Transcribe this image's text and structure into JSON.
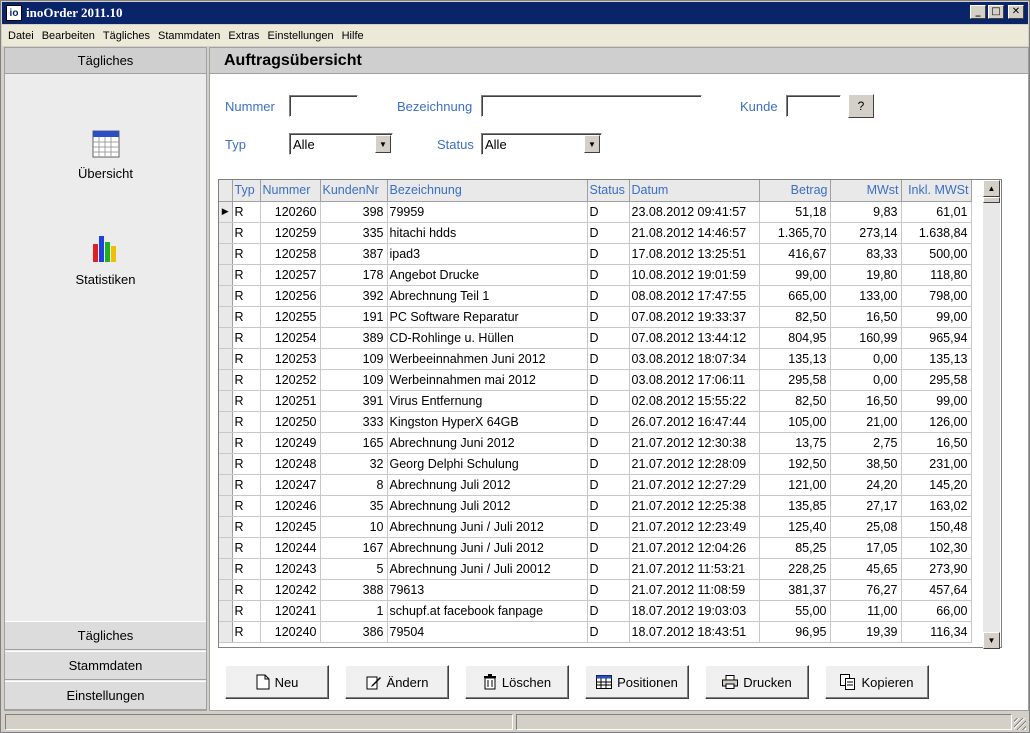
{
  "window": {
    "title": "inoOrder 2011.10",
    "icon_text": "io"
  },
  "menu": [
    "Datei",
    "Bearbeiten",
    "Tägliches",
    "Stammdaten",
    "Extras",
    "Einstellungen",
    "Hilfe"
  ],
  "sidebar": {
    "header": "Tägliches",
    "items": [
      {
        "label": "Übersicht",
        "icon": "calendar-icon"
      },
      {
        "label": "Statistiken",
        "icon": "bar-chart-icon"
      }
    ],
    "bottom_buttons": [
      "Tägliches",
      "Stammdaten",
      "Einstellungen"
    ]
  },
  "main": {
    "title": "Auftragsübersicht",
    "filters": {
      "nummer_label": "Nummer",
      "nummer_value": "",
      "bezeichnung_label": "Bezeichnung",
      "bezeichnung_value": "",
      "kunde_label": "Kunde",
      "kunde_value": "",
      "lookup_label": "?",
      "typ_label": "Typ",
      "typ_value": "Alle",
      "status_label": "Status",
      "status_value": "Alle"
    },
    "columns": [
      "Typ",
      "Nummer",
      "KundenNr",
      "Bezeichnung",
      "Status",
      "Datum",
      "Betrag",
      "MWst",
      "Inkl. MWSt"
    ],
    "rows": [
      [
        "R",
        "120260",
        "398",
        "79959",
        "D",
        "23.08.2012 09:41:57",
        "51,18",
        "9,83",
        "61,01"
      ],
      [
        "R",
        "120259",
        "335",
        "hitachi hdds",
        "D",
        "21.08.2012 14:46:57",
        "1.365,70",
        "273,14",
        "1.638,84"
      ],
      [
        "R",
        "120258",
        "387",
        "ipad3",
        "D",
        "17.08.2012 13:25:51",
        "416,67",
        "83,33",
        "500,00"
      ],
      [
        "R",
        "120257",
        "178",
        "Angebot Drucke",
        "D",
        "10.08.2012 19:01:59",
        "99,00",
        "19,80",
        "118,80"
      ],
      [
        "R",
        "120256",
        "392",
        "Abrechnung Teil 1",
        "D",
        "08.08.2012 17:47:55",
        "665,00",
        "133,00",
        "798,00"
      ],
      [
        "R",
        "120255",
        "191",
        "PC Software Reparatur",
        "D",
        "07.08.2012 19:33:37",
        "82,50",
        "16,50",
        "99,00"
      ],
      [
        "R",
        "120254",
        "389",
        "CD-Rohlinge u. Hüllen",
        "D",
        "07.08.2012 13:44:12",
        "804,95",
        "160,99",
        "965,94"
      ],
      [
        "R",
        "120253",
        "109",
        "Werbeeinnahmen Juni 2012",
        "D",
        "03.08.2012 18:07:34",
        "135,13",
        "0,00",
        "135,13"
      ],
      [
        "R",
        "120252",
        "109",
        "Werbeinnahmen mai 2012",
        "D",
        "03.08.2012 17:06:11",
        "295,58",
        "0,00",
        "295,58"
      ],
      [
        "R",
        "120251",
        "391",
        "Virus Entfernung",
        "D",
        "02.08.2012 15:55:22",
        "82,50",
        "16,50",
        "99,00"
      ],
      [
        "R",
        "120250",
        "333",
        "Kingston HyperX 64GB",
        "D",
        "26.07.2012 16:47:44",
        "105,00",
        "21,00",
        "126,00"
      ],
      [
        "R",
        "120249",
        "165",
        "Abrechnung Juni 2012",
        "D",
        "21.07.2012 12:30:38",
        "13,75",
        "2,75",
        "16,50"
      ],
      [
        "R",
        "120248",
        "32",
        "Georg Delphi Schulung",
        "D",
        "21.07.2012 12:28:09",
        "192,50",
        "38,50",
        "231,00"
      ],
      [
        "R",
        "120247",
        "8",
        "Abrechnung Juli 2012",
        "D",
        "21.07.2012 12:27:29",
        "121,00",
        "24,20",
        "145,20"
      ],
      [
        "R",
        "120246",
        "35",
        "Abrechnung Juli 2012",
        "D",
        "21.07.2012 12:25:38",
        "135,85",
        "27,17",
        "163,02"
      ],
      [
        "R",
        "120245",
        "10",
        "Abrechnung Juni / Juli 2012",
        "D",
        "21.07.2012 12:23:49",
        "125,40",
        "25,08",
        "150,48"
      ],
      [
        "R",
        "120244",
        "167",
        "Abrechnung Juni / Juli 2012",
        "D",
        "21.07.2012 12:04:26",
        "85,25",
        "17,05",
        "102,30"
      ],
      [
        "R",
        "120243",
        "5",
        "Abrechnung Juni / Juli 20012",
        "D",
        "21.07.2012 11:53:21",
        "228,25",
        "45,65",
        "273,90"
      ],
      [
        "R",
        "120242",
        "388",
        "79613",
        "D",
        "21.07.2012 11:08:59",
        "381,37",
        "76,27",
        "457,64"
      ],
      [
        "R",
        "120241",
        "1",
        "schupf.at facebook fanpage",
        "D",
        "18.07.2012 19:03:03",
        "55,00",
        "11,00",
        "66,00"
      ],
      [
        "R",
        "120240",
        "386",
        "79504",
        "D",
        "18.07.2012 18:43:51",
        "96,95",
        "19,39",
        "116,34"
      ]
    ],
    "actions": [
      {
        "label": "Neu",
        "icon": "new-document-icon"
      },
      {
        "label": "Ändern",
        "icon": "edit-icon"
      },
      {
        "label": "Löschen",
        "icon": "trash-icon"
      },
      {
        "label": "Positionen",
        "icon": "table-icon"
      },
      {
        "label": "Drucken",
        "icon": "printer-icon"
      },
      {
        "label": "Kopieren",
        "icon": "copy-icon"
      }
    ]
  }
}
